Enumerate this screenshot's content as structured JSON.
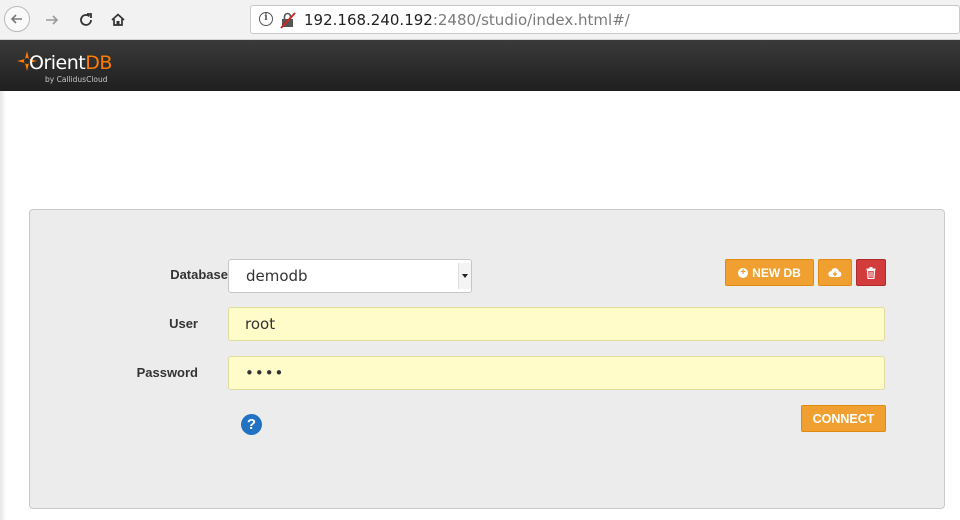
{
  "browser": {
    "url_host": "192.168.240.192",
    "url_rest": ":2480/studio/index.html#/"
  },
  "app": {
    "logo_main": "Orient",
    "logo_accent": "DB",
    "logo_sub": "by CallidusCloud"
  },
  "login": {
    "database_label": "Database",
    "database_value": "demodb",
    "user_label": "User",
    "user_value": "root",
    "password_label": "Password",
    "password_value": "••••",
    "new_db_label": "NEW DB",
    "connect_label": "CONNECT",
    "help_glyph": "?"
  },
  "colors": {
    "accent": "#f0a030",
    "danger": "#d33c3c",
    "input_bg": "#fffcc9",
    "help": "#2272c3"
  },
  "icons": [
    "back-arrow-icon",
    "forward-arrow-icon",
    "reload-icon",
    "home-icon",
    "info-icon",
    "insecure-lock-icon",
    "plus-circle-icon",
    "cloud-download-icon",
    "trash-icon",
    "help-icon"
  ]
}
